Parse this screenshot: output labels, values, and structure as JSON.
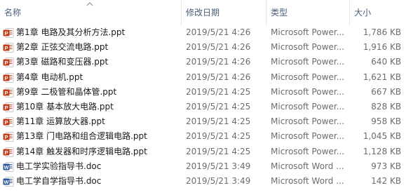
{
  "columns": {
    "name": "名称",
    "modified": "修改日期",
    "type": "类型",
    "size": "大小"
  },
  "files": [
    {
      "name": "第1章 电路及其分析方法.ppt",
      "modified": "2019/5/21 4:26",
      "type": "Microsoft Power...",
      "size": "1,786 KB",
      "icon": "powerpoint-icon"
    },
    {
      "name": "第2章 正弦交流电路.ppt",
      "modified": "2019/5/21 4:26",
      "type": "Microsoft Power...",
      "size": "1,916 KB",
      "icon": "powerpoint-icon"
    },
    {
      "name": "第3章 磁路和变压器.ppt",
      "modified": "2019/5/21 4:26",
      "type": "Microsoft Power...",
      "size": "640 KB",
      "icon": "powerpoint-icon"
    },
    {
      "name": "第4章 电动机.ppt",
      "modified": "2019/5/21 4:26",
      "type": "Microsoft Power...",
      "size": "1,621 KB",
      "icon": "powerpoint-icon"
    },
    {
      "name": "第9章 二极管和晶体管.ppt",
      "modified": "2019/5/21 4:25",
      "type": "Microsoft Power...",
      "size": "667 KB",
      "icon": "powerpoint-icon"
    },
    {
      "name": "第10章 基本放大电路.ppt",
      "modified": "2019/5/21 4:25",
      "type": "Microsoft Power...",
      "size": "828 KB",
      "icon": "powerpoint-icon"
    },
    {
      "name": "第11章 运算放大器.ppt",
      "modified": "2019/5/21 4:25",
      "type": "Microsoft Power...",
      "size": "958 KB",
      "icon": "powerpoint-icon"
    },
    {
      "name": "第13章 门电路和组合逻辑电路.ppt",
      "modified": "2019/5/21 4:25",
      "type": "Microsoft Power...",
      "size": "1,045 KB",
      "icon": "powerpoint-icon"
    },
    {
      "name": "第14章 触发器和时序逻辑电路.ppt",
      "modified": "2019/5/21 4:25",
      "type": "Microsoft Power...",
      "size": "1,128 KB",
      "icon": "powerpoint-icon"
    },
    {
      "name": "电工学实验指导书.doc",
      "modified": "2019/5/21 3:49",
      "type": "Microsoft Word ...",
      "size": "973 KB",
      "icon": "word-icon"
    },
    {
      "name": "电工学自学指导书.doc",
      "modified": "2019/5/21 3:49",
      "type": "Microsoft Word ...",
      "size": "142 KB",
      "icon": "word-icon"
    }
  ]
}
